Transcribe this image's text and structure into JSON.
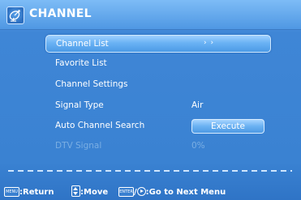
{
  "header": {
    "title": "CHANNEL",
    "icon": "satellite-dish-icon"
  },
  "menu": {
    "items": [
      {
        "label": "Channel List",
        "value": "› ›",
        "selected": true,
        "enabled": true
      },
      {
        "label": "Favorite List",
        "value": "",
        "enabled": true
      },
      {
        "label": "Channel Settings",
        "value": "",
        "enabled": true
      },
      {
        "label": "Signal Type",
        "value": "Air",
        "enabled": true
      },
      {
        "label": "Auto Channel Search",
        "value": "Execute",
        "enabled": true
      },
      {
        "label": "DTV Signal",
        "value": "0%",
        "enabled": false
      }
    ]
  },
  "footer": {
    "return_key": "MENU",
    "return_label": ":Return",
    "move_label": ":Move",
    "enter_key": "ENTER",
    "next_label": ":Go to Next Menu"
  },
  "colors": {
    "background": "#3a82d2",
    "highlight": "#6ab2f4",
    "disabled_text": "#7aaee3"
  }
}
